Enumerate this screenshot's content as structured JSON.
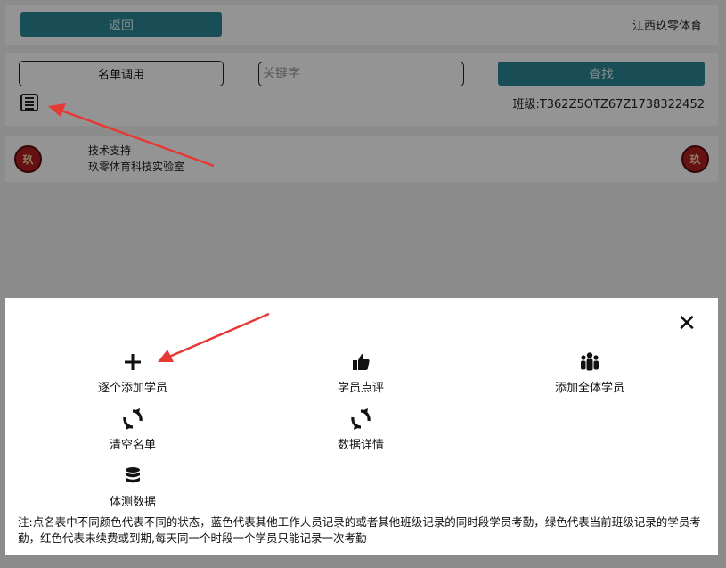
{
  "header": {
    "back_label": "返回",
    "brand": "江西玖零体育"
  },
  "toolbar": {
    "roster_label": "名单调用",
    "keyword_placeholder": "关键字",
    "search_label": "查找",
    "class_code": "班级:T362Z5OTZ67Z1738322452"
  },
  "footer": {
    "seal_text": "玖",
    "support_line1": "技术支持",
    "support_line2": "玖零体育科技实验室"
  },
  "modal": {
    "close_icon": "close-icon",
    "actions": [
      {
        "label": "逐个添加学员",
        "icon": "plus-icon"
      },
      {
        "label": "学员点评",
        "icon": "thumbs-up-icon"
      },
      {
        "label": "添加全体学员",
        "icon": "group-icon"
      },
      {
        "label": "清空名单",
        "icon": "refresh-icon"
      },
      {
        "label": "数据详情",
        "icon": "refresh-icon"
      },
      {
        "label": "体测数据",
        "icon": "database-icon"
      }
    ],
    "note": "注:点名表中不同颜色代表不同的状态，蓝色代表其他工作人员记录的或者其他班级记录的同时段学员考勤，绿色代表当前班级记录的学员考勤，红色代表未续费或到期,每天同一个时段一个学员只能记录一次考勤"
  },
  "colors": {
    "accent": "#2e8797",
    "annotation_arrow": "#e53935"
  }
}
